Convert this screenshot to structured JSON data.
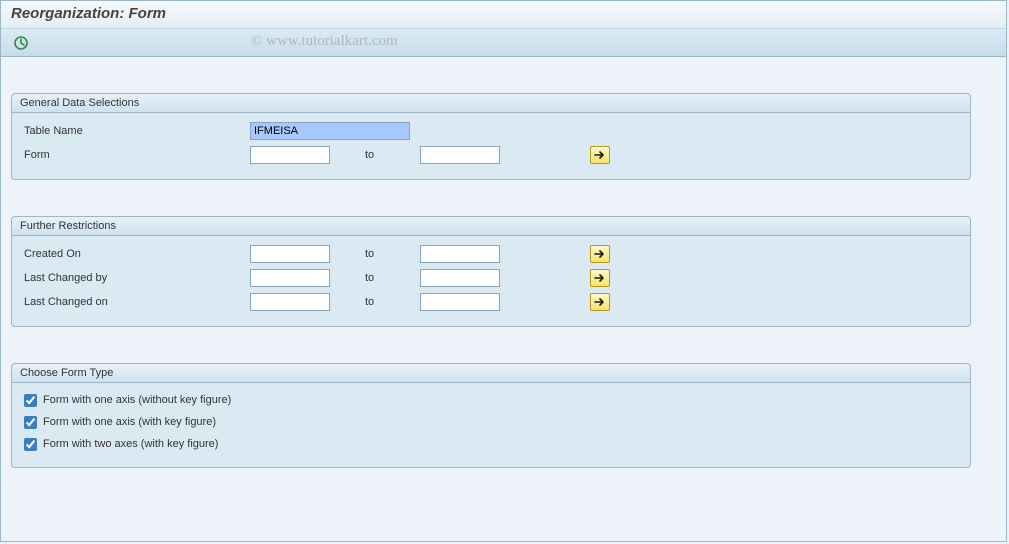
{
  "title": "Reorganization: Form",
  "watermark": "© www.tutorialkart.com",
  "groups": {
    "general": {
      "title": "General Data Selections",
      "table_name_label": "Table Name",
      "table_name_value": "IFMEISA",
      "form_label": "Form",
      "form_from": "",
      "to_label": "to",
      "form_to": ""
    },
    "further": {
      "title": "Further Restrictions",
      "created_on_label": "Created On",
      "created_on_from": "",
      "created_on_to": "",
      "last_changed_by_label": "Last Changed by",
      "last_changed_by_from": "",
      "last_changed_by_to": "",
      "last_changed_on_label": "Last Changed on",
      "last_changed_on_from": "",
      "last_changed_on_to": "",
      "to_label": "to"
    },
    "formtype": {
      "title": "Choose Form Type",
      "opt1": "Form with one axis (without key figure)",
      "opt2": "Form with one axis (with key figure)",
      "opt3": "Form with two axes (with key figure)"
    }
  }
}
